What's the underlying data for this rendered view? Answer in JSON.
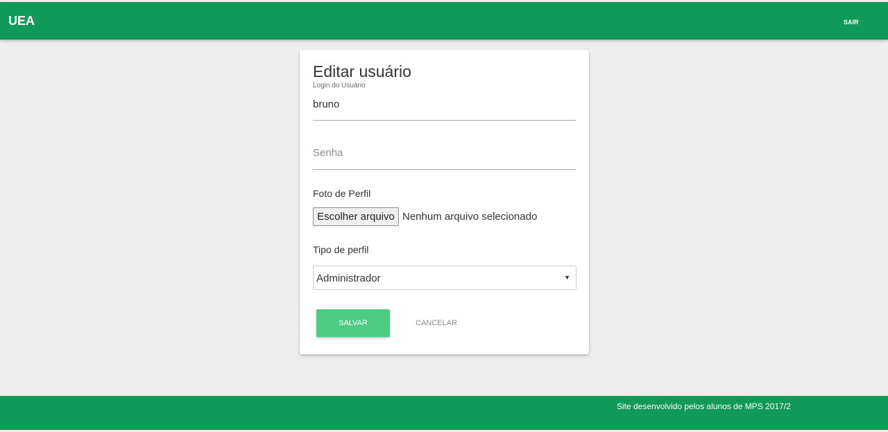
{
  "header": {
    "brand": "UEA",
    "logout_label": "SAIR"
  },
  "form": {
    "title": "Editar usuário",
    "login_label": "Login do Usuário",
    "login_value": "bruno",
    "password_placeholder": "Senha",
    "photo_label": "Foto de Perfil",
    "file_button_label": "Escolher arquivo",
    "file_status": "Nenhum arquivo selecionado",
    "profile_type_label": "Tipo de perfil",
    "profile_type_selected": "Administrador",
    "save_label": "SALVAR",
    "cancel_label": "CANCELAR"
  },
  "footer": {
    "text": "Site desenvolvido pelos alunos de MPS 2017/2"
  },
  "colors": {
    "brand_green": "#109a58",
    "button_green": "#4ccb82",
    "background": "#eeeeee"
  },
  "icons": {
    "select_caret": "caret-down-icon"
  }
}
